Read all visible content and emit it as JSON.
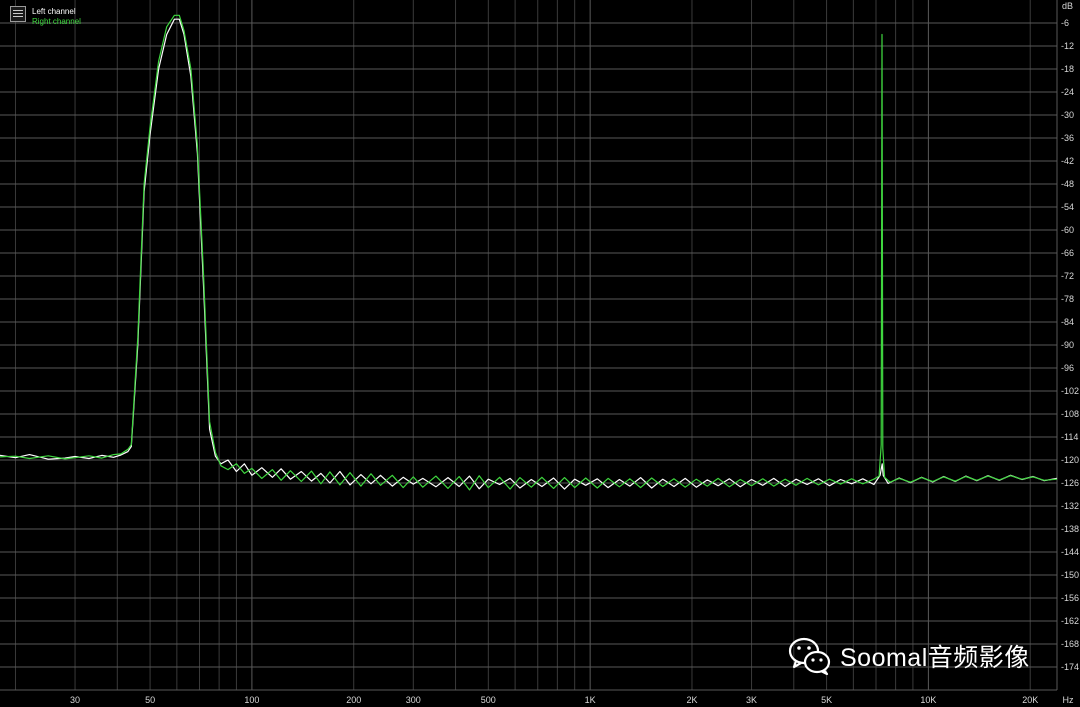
{
  "legend": {
    "left_label": "Left channel",
    "right_label": "Right channel"
  },
  "watermark": {
    "text": "Soomal音频影像",
    "icon": "wechat-icon"
  },
  "colors": {
    "background": "#000000",
    "grid": "#595959",
    "grid_minor": "#3a3a3a",
    "left_channel": "#ffffff",
    "right_channel": "#3fd63f",
    "tick_text": "#d8d8d8"
  },
  "chart_data": {
    "type": "line",
    "title": "",
    "xlabel": "Hz",
    "ylabel": "dB",
    "xscale": "log",
    "xlim": [
      18,
      24000
    ],
    "ylim": [
      -180,
      0
    ],
    "grid": true,
    "legend_position": "top-left",
    "x_tick_labels": [
      {
        "value": 30,
        "label": "30"
      },
      {
        "value": 50,
        "label": "50"
      },
      {
        "value": 100,
        "label": "100"
      },
      {
        "value": 200,
        "label": "200"
      },
      {
        "value": 300,
        "label": "300"
      },
      {
        "value": 500,
        "label": "500"
      },
      {
        "value": 1000,
        "label": "1K"
      },
      {
        "value": 2000,
        "label": "2K"
      },
      {
        "value": 3000,
        "label": "3K"
      },
      {
        "value": 5000,
        "label": "5K"
      },
      {
        "value": 10000,
        "label": "10K"
      },
      {
        "value": 20000,
        "label": "20K"
      }
    ],
    "y_tick_labels": [
      {
        "value": -6,
        "label": "-6"
      },
      {
        "value": -12,
        "label": "-12"
      },
      {
        "value": -18,
        "label": "-18"
      },
      {
        "value": -24,
        "label": "-24"
      },
      {
        "value": -30,
        "label": "-30"
      },
      {
        "value": -36,
        "label": "-36"
      },
      {
        "value": -42,
        "label": "-42"
      },
      {
        "value": -48,
        "label": "-48"
      },
      {
        "value": -54,
        "label": "-54"
      },
      {
        "value": -60,
        "label": "-60"
      },
      {
        "value": -66,
        "label": "-66"
      },
      {
        "value": -72,
        "label": "-72"
      },
      {
        "value": -78,
        "label": "-78"
      },
      {
        "value": -84,
        "label": "-84"
      },
      {
        "value": -90,
        "label": "-90"
      },
      {
        "value": -96,
        "label": "-96"
      },
      {
        "value": -102,
        "label": "-102"
      },
      {
        "value": -108,
        "label": "-108"
      },
      {
        "value": -114,
        "label": "-114"
      },
      {
        "value": -120,
        "label": "-120"
      },
      {
        "value": -126,
        "label": "-126"
      },
      {
        "value": -132,
        "label": "-132"
      },
      {
        "value": -138,
        "label": "-138"
      },
      {
        "value": -144,
        "label": "-144"
      },
      {
        "value": -150,
        "label": "-150"
      },
      {
        "value": -156,
        "label": "-156"
      },
      {
        "value": -162,
        "label": "-162"
      },
      {
        "value": -168,
        "label": "-168"
      },
      {
        "value": -174,
        "label": "-174"
      }
    ],
    "series": [
      {
        "name": "Left channel",
        "color": "#ffffff",
        "points": [
          [
            18,
            -118.8
          ],
          [
            20,
            -119.4
          ],
          [
            22,
            -118.6
          ],
          [
            25,
            -119.8
          ],
          [
            28,
            -119.5
          ],
          [
            30,
            -119.1
          ],
          [
            33,
            -119.6
          ],
          [
            36,
            -118.8
          ],
          [
            39,
            -119.3
          ],
          [
            41,
            -118.7
          ],
          [
            43,
            -117.8
          ],
          [
            44,
            -116.5
          ],
          [
            46,
            -90
          ],
          [
            48,
            -50
          ],
          [
            50,
            -35
          ],
          [
            53,
            -18
          ],
          [
            56,
            -9
          ],
          [
            59,
            -5
          ],
          [
            61,
            -5
          ],
          [
            63,
            -9
          ],
          [
            66,
            -20
          ],
          [
            69,
            -40
          ],
          [
            72,
            -75
          ],
          [
            75,
            -112
          ],
          [
            78,
            -119
          ],
          [
            81,
            -121
          ],
          [
            85,
            -120
          ],
          [
            90,
            -123
          ],
          [
            95,
            -121
          ],
          [
            100,
            -124
          ],
          [
            107,
            -122
          ],
          [
            115,
            -124.5
          ],
          [
            122,
            -122.3
          ],
          [
            130,
            -125
          ],
          [
            140,
            -123
          ],
          [
            150,
            -125.5
          ],
          [
            160,
            -123.5
          ],
          [
            170,
            -126
          ],
          [
            182,
            -123
          ],
          [
            195,
            -126.5
          ],
          [
            210,
            -123.8
          ],
          [
            225,
            -126.2
          ],
          [
            240,
            -124
          ],
          [
            260,
            -126.8
          ],
          [
            280,
            -124.5
          ],
          [
            300,
            -126.3
          ],
          [
            320,
            -124.8
          ],
          [
            350,
            -127
          ],
          [
            380,
            -124.6
          ],
          [
            410,
            -126.9
          ],
          [
            440,
            -124.2
          ],
          [
            470,
            -127.5
          ],
          [
            500,
            -125
          ],
          [
            540,
            -126.4
          ],
          [
            580,
            -124.8
          ],
          [
            620,
            -127.3
          ],
          [
            670,
            -125.1
          ],
          [
            720,
            -126.9
          ],
          [
            780,
            -124.7
          ],
          [
            840,
            -127.6
          ],
          [
            900,
            -125
          ],
          [
            970,
            -126.6
          ],
          [
            1050,
            -124.9
          ],
          [
            1130,
            -127.2
          ],
          [
            1220,
            -125.1
          ],
          [
            1310,
            -126.8
          ],
          [
            1410,
            -124.6
          ],
          [
            1520,
            -127.3
          ],
          [
            1640,
            -125
          ],
          [
            1770,
            -126.9
          ],
          [
            1910,
            -124.8
          ],
          [
            2060,
            -127.1
          ],
          [
            2220,
            -125.2
          ],
          [
            2390,
            -126.7
          ],
          [
            2580,
            -124.9
          ],
          [
            2780,
            -127
          ],
          [
            3000,
            -125.1
          ],
          [
            3240,
            -126.6
          ],
          [
            3490,
            -124.8
          ],
          [
            3770,
            -126.9
          ],
          [
            4060,
            -125
          ],
          [
            4380,
            -126.4
          ],
          [
            4730,
            -124.9
          ],
          [
            5100,
            -126.7
          ],
          [
            5500,
            -125.1
          ],
          [
            5930,
            -126.2
          ],
          [
            6400,
            -124.9
          ],
          [
            6900,
            -126.4
          ],
          [
            7200,
            -124
          ],
          [
            7300,
            -121
          ],
          [
            7350,
            -124
          ],
          [
            7600,
            -126.1
          ],
          [
            8200,
            -124.7
          ],
          [
            8850,
            -125.9
          ],
          [
            9550,
            -124.5
          ],
          [
            10300,
            -125.7
          ],
          [
            11100,
            -124.3
          ],
          [
            12000,
            -125.6
          ],
          [
            12900,
            -124.2
          ],
          [
            13900,
            -125.4
          ],
          [
            15000,
            -124.1
          ],
          [
            16200,
            -125.3
          ],
          [
            17500,
            -124
          ],
          [
            18900,
            -125.1
          ],
          [
            20400,
            -124.3
          ],
          [
            22000,
            -125.4
          ],
          [
            24000,
            -124.8
          ]
        ]
      },
      {
        "name": "Right channel",
        "color": "#3fd63f",
        "points": [
          [
            18,
            -119.2
          ],
          [
            20,
            -119
          ],
          [
            22,
            -119.6
          ],
          [
            25,
            -118.9
          ],
          [
            28,
            -119.7
          ],
          [
            30,
            -119.4
          ],
          [
            33,
            -118.9
          ],
          [
            36,
            -119.5
          ],
          [
            39,
            -118.6
          ],
          [
            41,
            -118.4
          ],
          [
            43,
            -117.2
          ],
          [
            44,
            -116
          ],
          [
            46,
            -88
          ],
          [
            48,
            -48
          ],
          [
            50,
            -33
          ],
          [
            53,
            -16
          ],
          [
            56,
            -7
          ],
          [
            59,
            -4
          ],
          [
            61,
            -4
          ],
          [
            63,
            -8
          ],
          [
            66,
            -18
          ],
          [
            69,
            -38
          ],
          [
            72,
            -72
          ],
          [
            75,
            -110
          ],
          [
            78,
            -118
          ],
          [
            81,
            -121.5
          ],
          [
            85,
            -122.5
          ],
          [
            90,
            -121
          ],
          [
            95,
            -123.5
          ],
          [
            100,
            -122.2
          ],
          [
            107,
            -124.8
          ],
          [
            115,
            -122.5
          ],
          [
            122,
            -125.3
          ],
          [
            130,
            -122.8
          ],
          [
            140,
            -125.6
          ],
          [
            150,
            -122.9
          ],
          [
            160,
            -126.2
          ],
          [
            170,
            -123.1
          ],
          [
            182,
            -126.5
          ],
          [
            195,
            -123.3
          ],
          [
            210,
            -126.8
          ],
          [
            225,
            -123.6
          ],
          [
            240,
            -126.6
          ],
          [
            260,
            -124
          ],
          [
            280,
            -127.2
          ],
          [
            300,
            -124.4
          ],
          [
            320,
            -127.1
          ],
          [
            350,
            -124.2
          ],
          [
            380,
            -127.4
          ],
          [
            410,
            -124.3
          ],
          [
            440,
            -127.8
          ],
          [
            470,
            -124.1
          ],
          [
            500,
            -127.2
          ],
          [
            540,
            -124.5
          ],
          [
            580,
            -127.6
          ],
          [
            620,
            -124.6
          ],
          [
            670,
            -127.1
          ],
          [
            720,
            -124.5
          ],
          [
            780,
            -127.4
          ],
          [
            840,
            -124.6
          ],
          [
            900,
            -127.2
          ],
          [
            970,
            -124.7
          ],
          [
            1050,
            -127.3
          ],
          [
            1130,
            -124.8
          ],
          [
            1220,
            -127
          ],
          [
            1310,
            -124.9
          ],
          [
            1410,
            -127.2
          ],
          [
            1520,
            -124.7
          ],
          [
            1640,
            -126.9
          ],
          [
            1770,
            -124.9
          ],
          [
            1910,
            -127.1
          ],
          [
            2060,
            -125
          ],
          [
            2220,
            -126.8
          ],
          [
            2390,
            -124.8
          ],
          [
            2580,
            -127
          ],
          [
            2780,
            -125.1
          ],
          [
            3000,
            -126.7
          ],
          [
            3240,
            -124.9
          ],
          [
            3490,
            -126.8
          ],
          [
            3770,
            -125
          ],
          [
            4060,
            -126.6
          ],
          [
            4380,
            -124.8
          ],
          [
            4730,
            -126.5
          ],
          [
            5100,
            -125
          ],
          [
            5500,
            -126.3
          ],
          [
            5930,
            -124.9
          ],
          [
            6400,
            -126.2
          ],
          [
            6900,
            -125
          ],
          [
            7150,
            -124.2
          ],
          [
            7250,
            -116
          ],
          [
            7290,
            -9
          ],
          [
            7330,
            -117
          ],
          [
            7420,
            -124.5
          ],
          [
            7700,
            -125.8
          ],
          [
            8200,
            -124.8
          ],
          [
            8850,
            -125.8
          ],
          [
            9550,
            -124.6
          ],
          [
            10300,
            -125.6
          ],
          [
            11100,
            -124.4
          ],
          [
            12000,
            -125.5
          ],
          [
            12900,
            -124.3
          ],
          [
            13900,
            -125.3
          ],
          [
            15000,
            -124.2
          ],
          [
            16200,
            -125.2
          ],
          [
            17500,
            -124.1
          ],
          [
            18900,
            -125
          ],
          [
            20400,
            -124.4
          ],
          [
            22000,
            -125.3
          ],
          [
            24000,
            -125
          ]
        ]
      }
    ]
  }
}
